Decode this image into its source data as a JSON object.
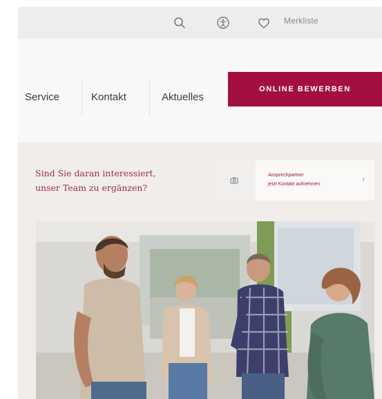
{
  "utility": {
    "bookmarks_label": "Merkliste",
    "icons": [
      "search-icon",
      "accessibility-icon",
      "heart-icon"
    ]
  },
  "nav": {
    "items": [
      "Service",
      "Kontakt",
      "Aktuelles"
    ],
    "apply_label": "ONLINE BEWERBEN"
  },
  "invite": {
    "line1": "Sind Sie daran interessiert,",
    "line2": "unser Team zu ergänzen?"
  },
  "contact": {
    "line1": "Ansprechpartner",
    "line2": "jetzt Kontakt aufnehmen"
  },
  "colors": {
    "brand": "#a3103f",
    "band": "#f1ede9"
  }
}
